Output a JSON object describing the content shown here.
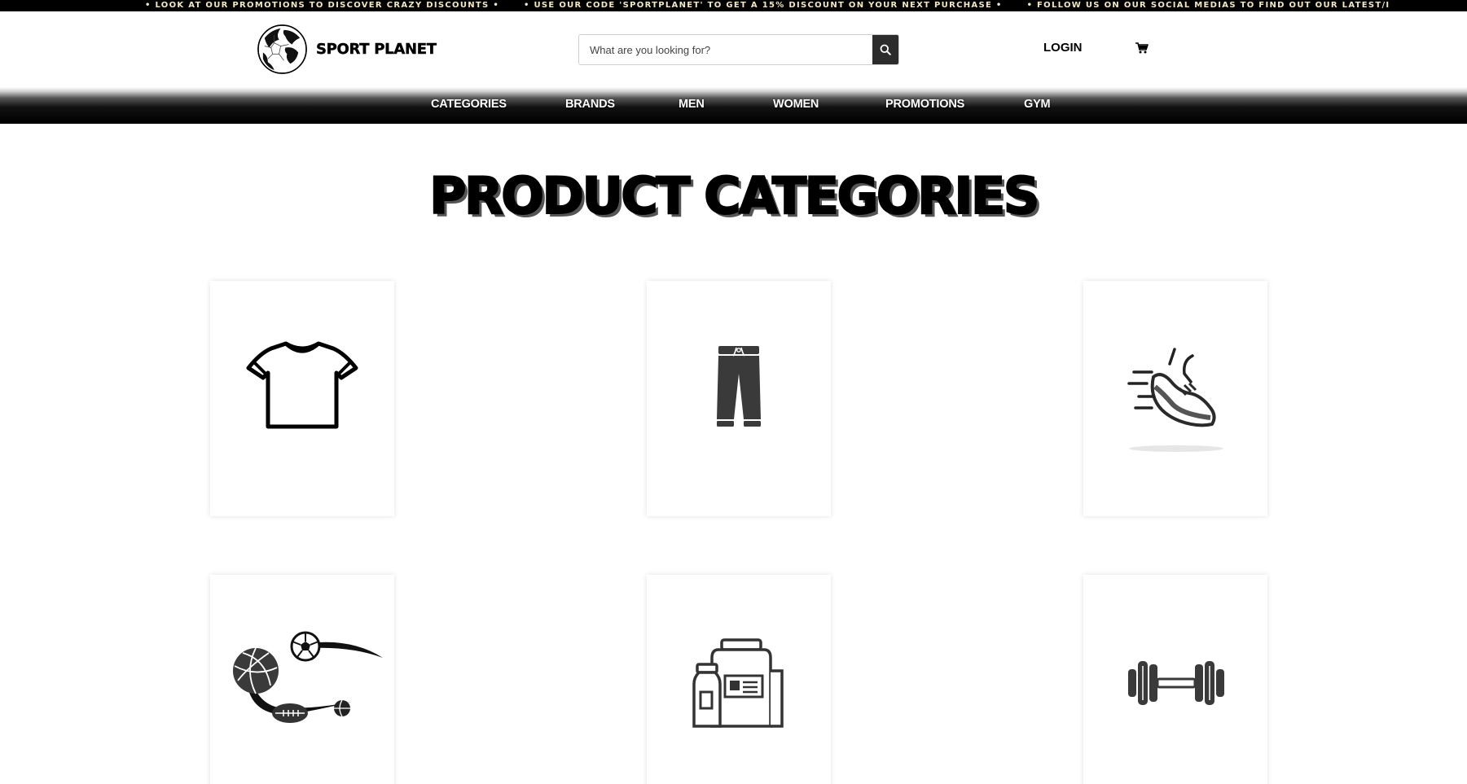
{
  "ticker": {
    "messages": [
      "• LOOK AT OUR PROMOTIONS TO DISCOVER CRAZY DISCOUNTS •",
      "• USE OUR CODE 'SPORTPLANET' TO GET A 15% DISCOUNT ON YOUR NEXT PURCHASE •",
      "• FOLLOW US ON OUR SOCIAL MEDIAS TO FIND OUT OUR LATEST/I"
    ]
  },
  "header": {
    "brand": "SPORT PLANET",
    "logo_icon": "globe-soccer-ball-icon",
    "search": {
      "placeholder": "What are you looking for?",
      "value": "",
      "button_icon": "search-icon"
    },
    "login_label": "LOGIN",
    "cart_icon": "cart-icon"
  },
  "nav": {
    "items": [
      "CATEGORIES",
      "BRANDS",
      "MEN",
      "WOMEN",
      "PROMOTIONS",
      "GYM"
    ]
  },
  "main": {
    "title": "PRODUCT CATEGORIES",
    "category_icons": [
      "t-shirt-icon",
      "pants-icon",
      "running-shoe-icon",
      "balls-icon",
      "supplements-icon",
      "dumbbell-icon"
    ]
  },
  "colors": {
    "ticker_bg": "#000000",
    "ticker_text": "#f3e6c4",
    "nav_bg": "#000000",
    "search_button": "#2c2c2c",
    "icon_dark": "#3a3a3a"
  }
}
